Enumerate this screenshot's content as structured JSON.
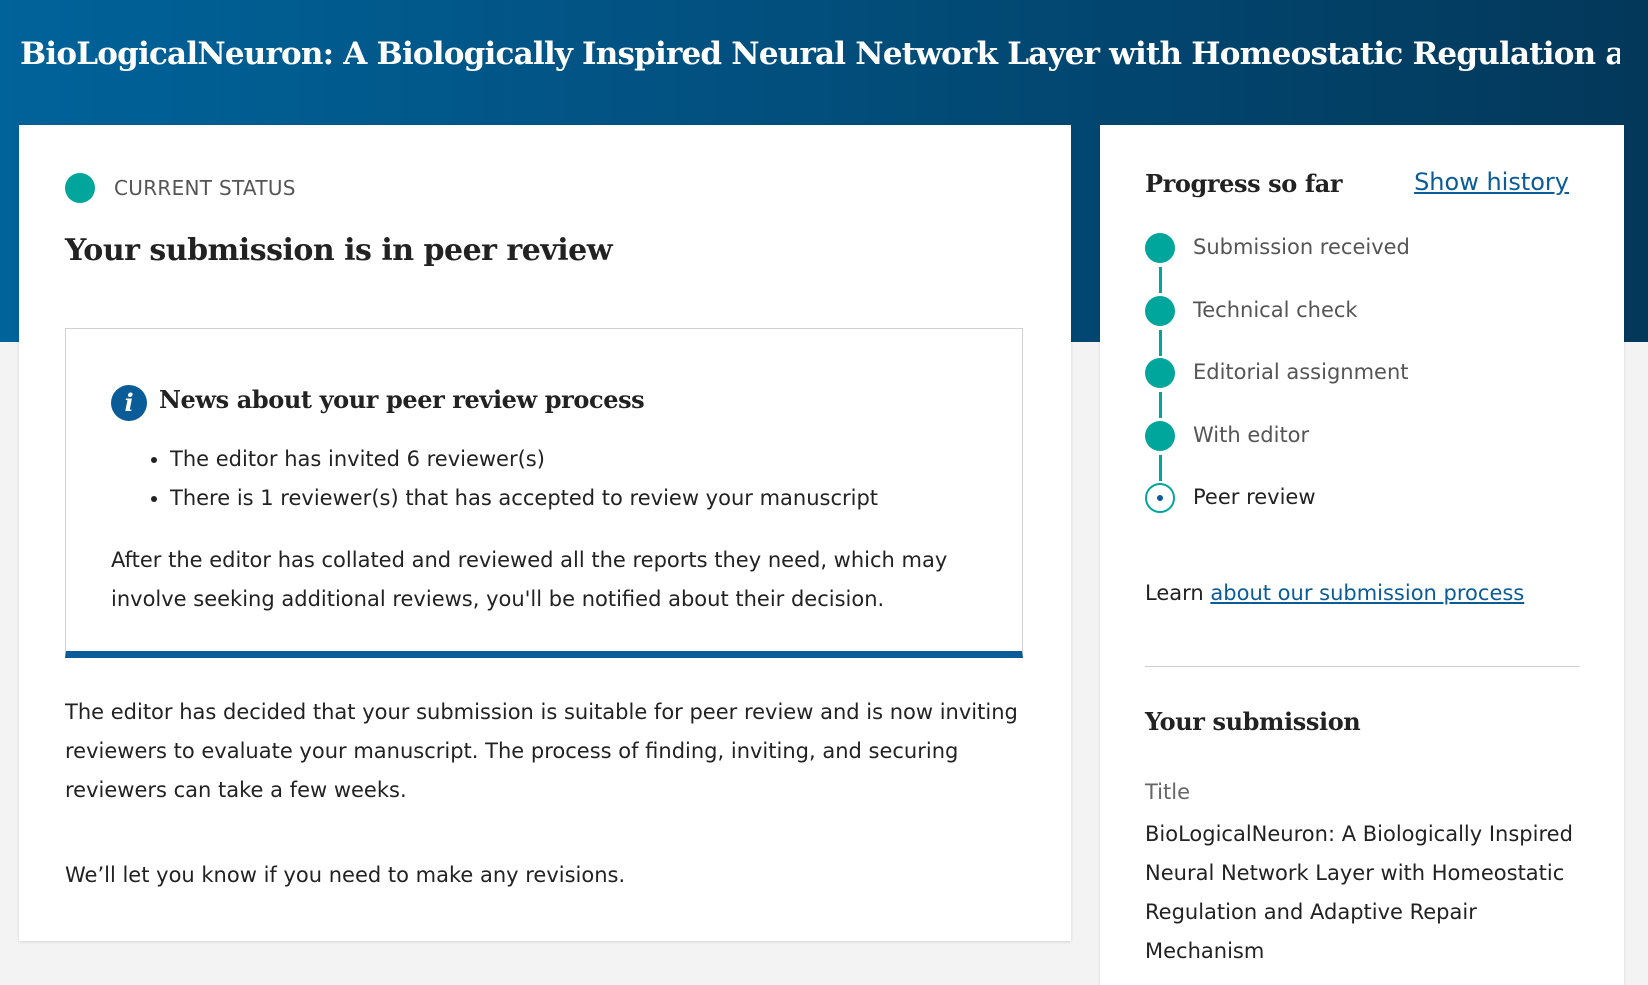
{
  "page": {
    "title": "BioLogicalNeuron: A Biologically Inspired Neural Network Layer with Homeostatic Regulation a..."
  },
  "status": {
    "label": "CURRENT STATUS",
    "heading": "Your submission is in peer review"
  },
  "news": {
    "title": "News about your peer review process",
    "items": [
      "The editor has invited 6 reviewer(s)",
      "There is 1 reviewer(s) that has accepted to review your manuscript"
    ],
    "body": "After the editor has collated and reviewed all the reports they need, which may involve seeking additional reviews, you'll be notified about their decision."
  },
  "main": {
    "paragraph_1": "The editor has decided that your submission is suitable for peer review and is now inviting reviewers to evaluate your manuscript. The process of finding, inviting, and securing reviewers can take a few weeks.",
    "paragraph_2": "We’ll let you know if you need to make any revisions."
  },
  "progress": {
    "heading": "Progress so far",
    "show_history": "Show history",
    "steps": [
      {
        "label": "Submission received",
        "state": "done"
      },
      {
        "label": "Technical check",
        "state": "done"
      },
      {
        "label": "Editorial assignment",
        "state": "done"
      },
      {
        "label": "With editor",
        "state": "done"
      },
      {
        "label": "Peer review",
        "state": "current"
      }
    ],
    "learn_prefix": "Learn",
    "learn_link": "about our submission process"
  },
  "submission": {
    "heading": "Your submission",
    "title_label": "Title",
    "title_value": "BioLogicalNeuron: A Biologically Inspired Neural Network Layer with Homeostatic Regulation and Adaptive Repair Mechanism"
  },
  "colors": {
    "accent_teal": "#00a69c",
    "brand_blue": "#0a5c99",
    "banner_start": "#00639a",
    "banner_end": "#03385a"
  }
}
